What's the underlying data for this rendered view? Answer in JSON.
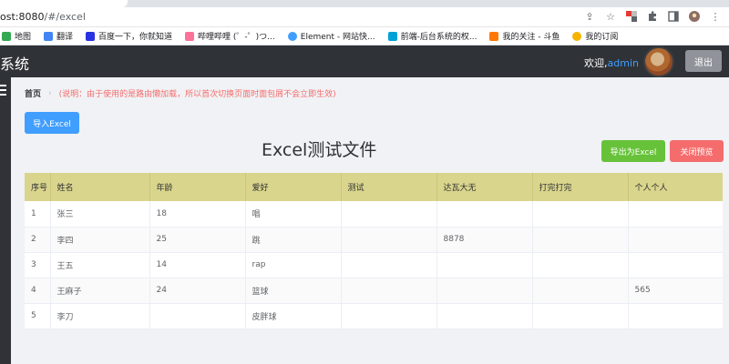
{
  "browser": {
    "tab_title": "Excel测试文件",
    "url_host": "ost:8080",
    "url_path": "/#/excel",
    "bookmarks": [
      {
        "label": "地图",
        "icon": "map-icon",
        "color": "#34a853"
      },
      {
        "label": "翻译",
        "icon": "translate-icon",
        "color": "#4285f4"
      },
      {
        "label": "百度一下，你就知道",
        "icon": "baidu-icon",
        "color": "#2932e1"
      },
      {
        "label": "哔哩哔哩 (゜-゜)つ...",
        "icon": "bilibili-icon",
        "color": "#fb7299"
      },
      {
        "label": "Element - 网站快...",
        "icon": "element-icon",
        "color": "#409eff"
      },
      {
        "label": "前端-后台系统的权...",
        "icon": "frontend-icon",
        "color": "#00a1d6"
      },
      {
        "label": "我的关注 - 斗鱼",
        "icon": "douyu-icon",
        "color": "#ff7700"
      },
      {
        "label": "我的订阅",
        "icon": "subscription-icon",
        "color": "#f4b400"
      }
    ]
  },
  "header": {
    "title": "系统",
    "welcome_prefix": "欢迎,",
    "username": "admin",
    "logout_label": "退出"
  },
  "breadcrumb": {
    "home": "首页",
    "note": "(说明：由于使用的是路由懒加载，所以首次切换页面时面包屑不会立即生效)"
  },
  "actions": {
    "import_label": "导入Excel",
    "export_label": "导出为Excel",
    "close_preview_label": "关闭预览"
  },
  "document": {
    "title": "Excel测试文件"
  },
  "table": {
    "headers": [
      "序号",
      "姓名",
      "年龄",
      "爱好",
      "测试",
      "达瓦大无",
      "打完打完",
      "个人个人"
    ],
    "rows": [
      [
        "1",
        "张三",
        "18",
        "唱",
        "",
        "",
        "",
        ""
      ],
      [
        "2",
        "李四",
        "25",
        "跳",
        "",
        "8878",
        "",
        ""
      ],
      [
        "3",
        "王五",
        "14",
        "rap",
        "",
        "",
        "",
        ""
      ],
      [
        "4",
        "王麻子",
        "24",
        "篮球",
        "",
        "",
        "",
        "565"
      ],
      [
        "5",
        "李刀",
        "",
        "皮胖球",
        "",
        "",
        "",
        ""
      ]
    ]
  }
}
